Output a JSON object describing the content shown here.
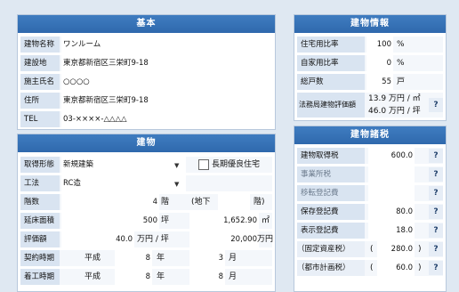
{
  "kihon": {
    "title": "基本",
    "rows": [
      {
        "label": "建物名称",
        "value": "ワンルーム"
      },
      {
        "label": "建設地",
        "value": "東京都新宿区三栄町9-18"
      },
      {
        "label": "施主氏名",
        "value": "○○○○"
      },
      {
        "label": "住所",
        "value": "東京都新宿区三栄町9-18"
      },
      {
        "label": "TEL",
        "value": "03-××××-△△△△"
      }
    ]
  },
  "tatemono": {
    "title": "建物",
    "keitai_label": "取得形態",
    "keitai_value": "新規建築",
    "checkbox_label": "長期優良住宅",
    "kouhou_label": "工法",
    "kouhou_value": "RC造",
    "kaisu_label": "階数",
    "kaisu_value": "4",
    "kaisu_unit": "階",
    "chika_label": "(地下",
    "chika_unit": "階)",
    "menseki_label": "延床面積",
    "menseki_tsubo": "500",
    "tsubo_unit": "坪",
    "menseki_m2": "1,652.90",
    "m2_unit": "㎡",
    "hyoka_label": "評価額",
    "hyoka_tsubo": "40.0",
    "hyoka_tsubo_unit": "万円 / 坪",
    "hyoka_m2": "20,000",
    "hyoka_m2_unit": "万円",
    "keiyaku_label": "契約時期",
    "keiyaku_era": "平成",
    "keiyaku_year": "8",
    "keiyaku_year_unit": "年",
    "keiyaku_month": "3",
    "keiyaku_month_unit": "月",
    "chakko_label": "着工時期",
    "chakko_era": "平成",
    "chakko_year": "8",
    "chakko_year_unit": "年",
    "chakko_month": "8",
    "chakko_month_unit": "月"
  },
  "jouhou": {
    "title": "建物情報",
    "rows": [
      {
        "label": "住宅用比率",
        "value": "100",
        "unit": "%"
      },
      {
        "label": "自家用比率",
        "value": "0",
        "unit": "%"
      },
      {
        "label": "総戸数",
        "value": "55",
        "unit": "戸"
      }
    ],
    "hyoka_label": "法務局建物評価額",
    "hyoka_line1": "13.9 万円 / ㎡",
    "hyoka_line2": "46.0 万円 / 坪",
    "q": "?"
  },
  "shozei": {
    "title": "建物諸税",
    "rows": [
      {
        "label": "建物取得税",
        "value": "600.0",
        "gray": false,
        "paren": false
      },
      {
        "label": "事業所税",
        "value": "",
        "gray": true,
        "paren": false
      },
      {
        "label": "移転登記費",
        "value": "",
        "gray": true,
        "paren": false
      },
      {
        "label": "保存登記費",
        "value": "80.0",
        "gray": false,
        "paren": false
      },
      {
        "label": "表示登記費",
        "value": "18.0",
        "gray": false,
        "paren": false
      },
      {
        "label": "（固定資産税）",
        "value": "280.0",
        "gray": false,
        "paren": true
      },
      {
        "label": "（都市計画税）",
        "value": "60.0",
        "gray": false,
        "paren": true
      }
    ],
    "q": "?"
  },
  "colors": {
    "header": "#2f69ad",
    "label_bg": "#d9e4f1",
    "page_bg": "#dfe8f2"
  }
}
